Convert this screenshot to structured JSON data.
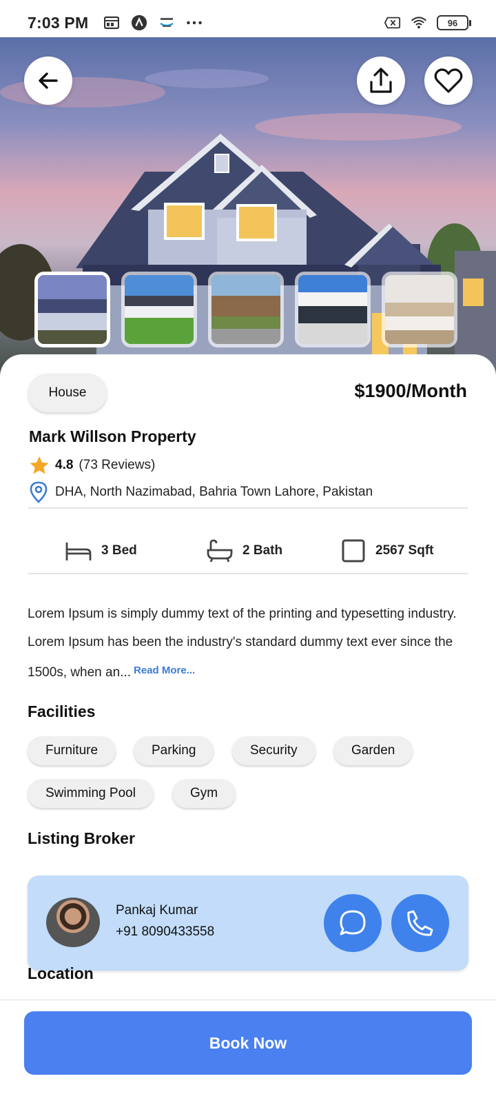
{
  "status_bar": {
    "time": "7:03 PM",
    "battery": "96",
    "icons": [
      "dashboard-icon",
      "app-a-icon",
      "amazon-icon",
      "more-dots-icon",
      "no-sim-icon",
      "wifi-icon",
      "battery-icon"
    ]
  },
  "hero": {
    "back_icon": "arrow-left-icon",
    "share_icon": "share-icon",
    "favorite_icon": "heart-icon",
    "thumbnails": [
      "house-1",
      "house-2",
      "house-3",
      "house-4",
      "interior-5"
    ]
  },
  "property": {
    "type": "House",
    "price": "$1900/Month",
    "name": "Mark Willson Property",
    "rating": "4.8",
    "reviews": "(73 Reviews)",
    "location": "DHA, North Nazimabad, Bahria Town Lahore, Pakistan"
  },
  "specs": {
    "bed": "3 Bed",
    "bath": "2 Bath",
    "area": "2567 Sqft"
  },
  "description": {
    "text": "Lorem Ipsum is simply dummy text of the printing and typesetting industry. Lorem Ipsum has been the industry's standard dummy text ever since the 1500s, when an...",
    "read_more": "Read More..."
  },
  "facilities": {
    "title": "Facilities",
    "items": [
      "Furniture",
      "Parking",
      "Security",
      "Garden",
      "Swimming Pool",
      "Gym"
    ]
  },
  "broker": {
    "title": "Listing Broker",
    "name": "Pankaj Kumar",
    "phone": "+91 8090433558"
  },
  "location_section": {
    "title": "Location"
  },
  "actions": {
    "book_now": "Book Now"
  },
  "colors": {
    "primary": "#4a80f0",
    "broker_card": "#c2dcf9",
    "star": "#f5a623",
    "link": "#3a7bd5"
  }
}
